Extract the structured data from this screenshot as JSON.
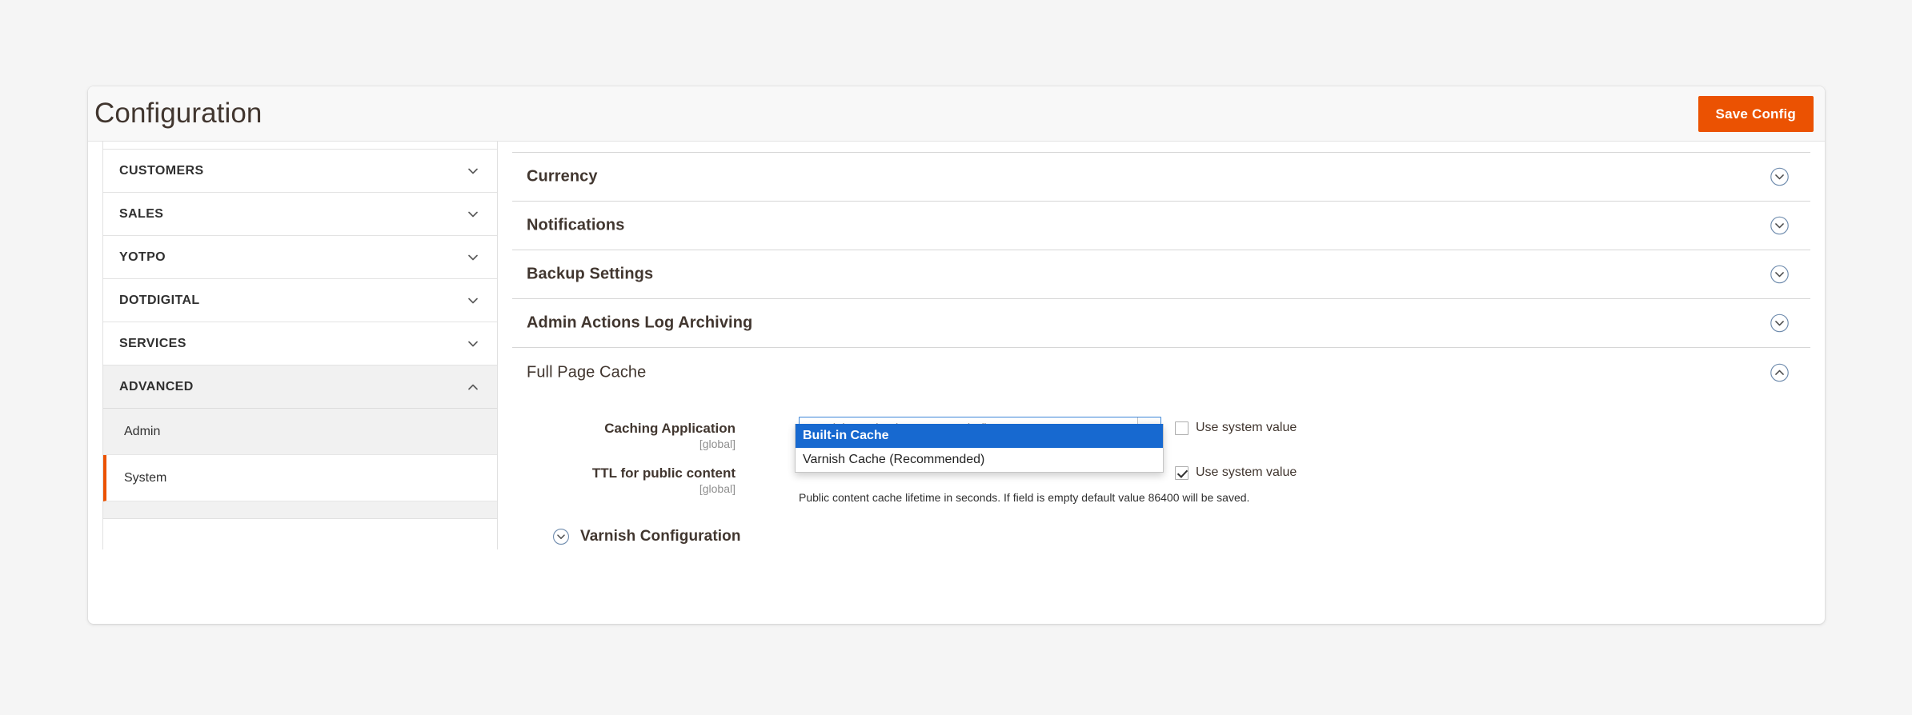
{
  "header": {
    "title": "Configuration",
    "save_label": "Save Config"
  },
  "sidebar": {
    "sections": [
      {
        "label": "CUSTOMERS",
        "icon": "chevron-down-icon",
        "open": false
      },
      {
        "label": "SALES",
        "icon": "chevron-down-icon",
        "open": false
      },
      {
        "label": "YOTPO",
        "icon": "chevron-down-icon",
        "open": false
      },
      {
        "label": "DOTDIGITAL",
        "icon": "chevron-down-icon",
        "open": false
      },
      {
        "label": "SERVICES",
        "icon": "chevron-down-icon",
        "open": false
      },
      {
        "label": "ADVANCED",
        "icon": "chevron-up-icon",
        "open": true
      }
    ],
    "subitems": [
      {
        "label": "Admin",
        "active": false
      },
      {
        "label": "System",
        "active": true
      }
    ]
  },
  "main": {
    "sections": [
      {
        "title": "Currency",
        "icon": "circled-chevron-down-icon",
        "expanded": false
      },
      {
        "title": "Notifications",
        "icon": "circled-chevron-down-icon",
        "expanded": false
      },
      {
        "title": "Backup Settings",
        "icon": "circled-chevron-down-icon",
        "expanded": false
      },
      {
        "title": "Admin Actions Log Archiving",
        "icon": "circled-chevron-down-icon",
        "expanded": false
      },
      {
        "title": "Full Page Cache",
        "icon": "circled-chevron-up-icon",
        "expanded": true
      }
    ],
    "full_page_cache": {
      "caching_application": {
        "label": "Caching Application",
        "scope": "[global]",
        "value": "Varnish Cache (Recommended)",
        "options": [
          {
            "label": "Built-in Cache",
            "highlighted": true
          },
          {
            "label": "Varnish Cache (Recommended)",
            "highlighted": false
          }
        ],
        "use_system_value_label": "Use system value",
        "use_system_value_checked": false
      },
      "ttl_public_content": {
        "label": "TTL for public content",
        "scope": "[global]",
        "note": "Public content cache lifetime in seconds. If field is empty default value 86400 will be saved.",
        "use_system_value_label": "Use system value",
        "use_system_value_checked": true
      },
      "varnish_configuration": {
        "title": "Varnish Configuration",
        "icon": "circled-chevron-down-icon"
      }
    }
  },
  "colors": {
    "accent_orange": "#eb5202",
    "highlight_blue": "#1769d0",
    "focus_border_blue": "#3c86d8"
  }
}
